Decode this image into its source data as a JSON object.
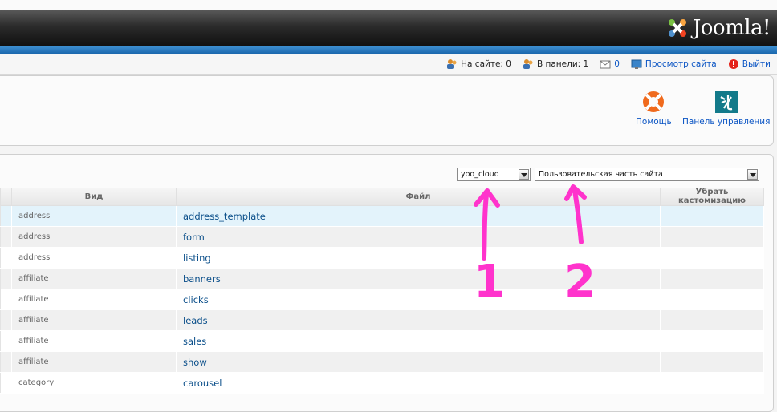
{
  "header": {
    "logo_text": "Joomla!"
  },
  "status_bar": {
    "on_site_label": "На сайте: 0",
    "in_panel_label": "В панели: 1",
    "messages_count": "0",
    "view_site_label": "Просмотр сайта",
    "logout_label": "Выйти"
  },
  "toolbar": {
    "help_label": "Помощь",
    "control_panel_label": "Панель управления"
  },
  "filters": {
    "template_value": "yoo_cloud",
    "location_value": "Пользовательская часть сайта"
  },
  "table": {
    "columns": [
      "Вид",
      "Файл",
      "Убрать кастомизацию"
    ],
    "rows": [
      {
        "view": "address",
        "file": "address_template"
      },
      {
        "view": "address",
        "file": "form"
      },
      {
        "view": "address",
        "file": "listing"
      },
      {
        "view": "affiliate",
        "file": "banners"
      },
      {
        "view": "affiliate",
        "file": "clicks"
      },
      {
        "view": "affiliate",
        "file": "leads"
      },
      {
        "view": "affiliate",
        "file": "sales"
      },
      {
        "view": "affiliate",
        "file": "show"
      },
      {
        "view": "category",
        "file": "carousel"
      }
    ]
  },
  "annotations": {
    "one": "1",
    "two": "2",
    "color": "#ff33cc"
  },
  "colors": {
    "link": "#0b55c4",
    "header_blue": "#1a67ad",
    "row_highlight": "#e3f3fb"
  }
}
